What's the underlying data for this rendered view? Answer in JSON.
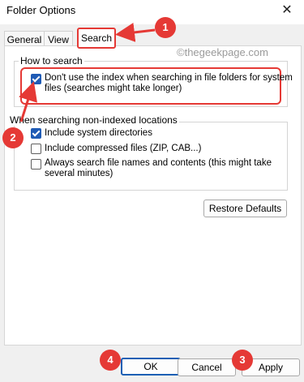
{
  "window": {
    "title": "Folder Options",
    "close_glyph": "✕"
  },
  "tabs": [
    {
      "label": "General"
    },
    {
      "label": "View"
    },
    {
      "label": "Search",
      "active": true
    }
  ],
  "watermark": "©thegeekpage.com",
  "groups": {
    "how_to_search": {
      "legend": "How to search",
      "options": [
        {
          "label_line1": "Don't use the index when searching in file folders for system",
          "label_line2": "files (searches might take longer)",
          "checked": true
        }
      ]
    },
    "non_indexed": {
      "legend": "When searching non-indexed locations",
      "options": [
        {
          "label": "Include system directories",
          "checked": true
        },
        {
          "label": "Include compressed files (ZIP, CAB...)",
          "checked": false
        },
        {
          "label_line1": "Always search file names and contents (this might take",
          "label_line2": "several minutes)",
          "checked": false
        }
      ]
    }
  },
  "buttons": {
    "restore_defaults": "Restore Defaults",
    "ok": "OK",
    "cancel": "Cancel",
    "apply": "Apply"
  },
  "annotations": {
    "badge_1": "1",
    "badge_2": "2",
    "badge_3": "3",
    "badge_4": "4",
    "color": "#e53935"
  },
  "colors": {
    "accent": "#1f5bb5",
    "highlight": "#e53935",
    "dialog_bg": "#f0f0f0"
  }
}
